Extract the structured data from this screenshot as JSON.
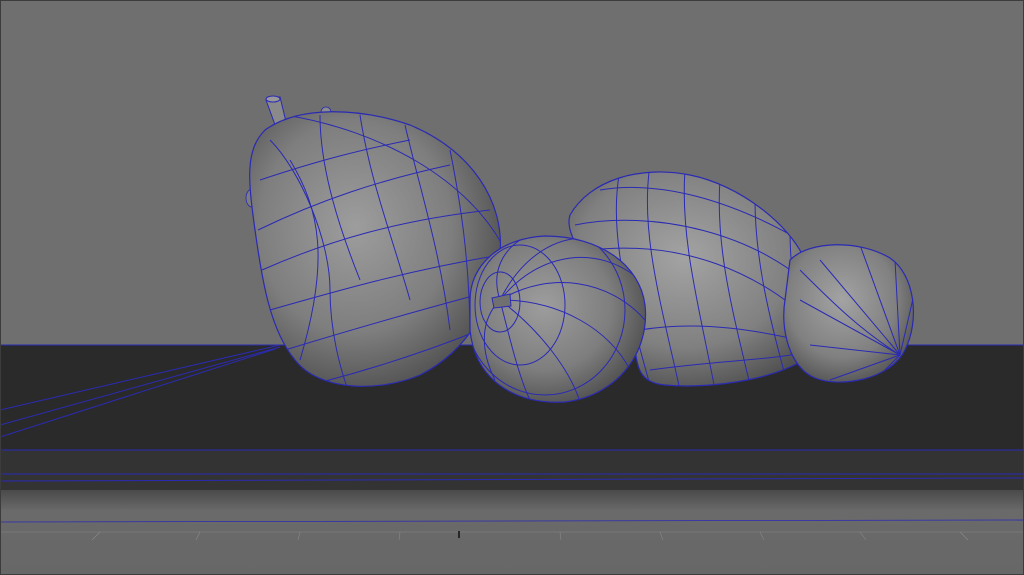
{
  "viewport": {
    "kind": "3d-modeling-viewport",
    "shading": "smooth-shaded-with-wireframe-on-shaded",
    "colors": {
      "background": "#6f6f6f",
      "table_top": "#2a2a2a",
      "table_front": "#323232",
      "floor": "#5e5e5e",
      "wireframe": "#2a2ab4",
      "grid": "#8a8a8a"
    },
    "objects": [
      {
        "name": "pear-large",
        "type": "nurbs-surface"
      },
      {
        "name": "apple-small",
        "type": "nurbs-surface"
      },
      {
        "name": "pear-lying",
        "type": "nurbs-surface"
      },
      {
        "name": "apple-right",
        "type": "nurbs-surface"
      }
    ]
  }
}
